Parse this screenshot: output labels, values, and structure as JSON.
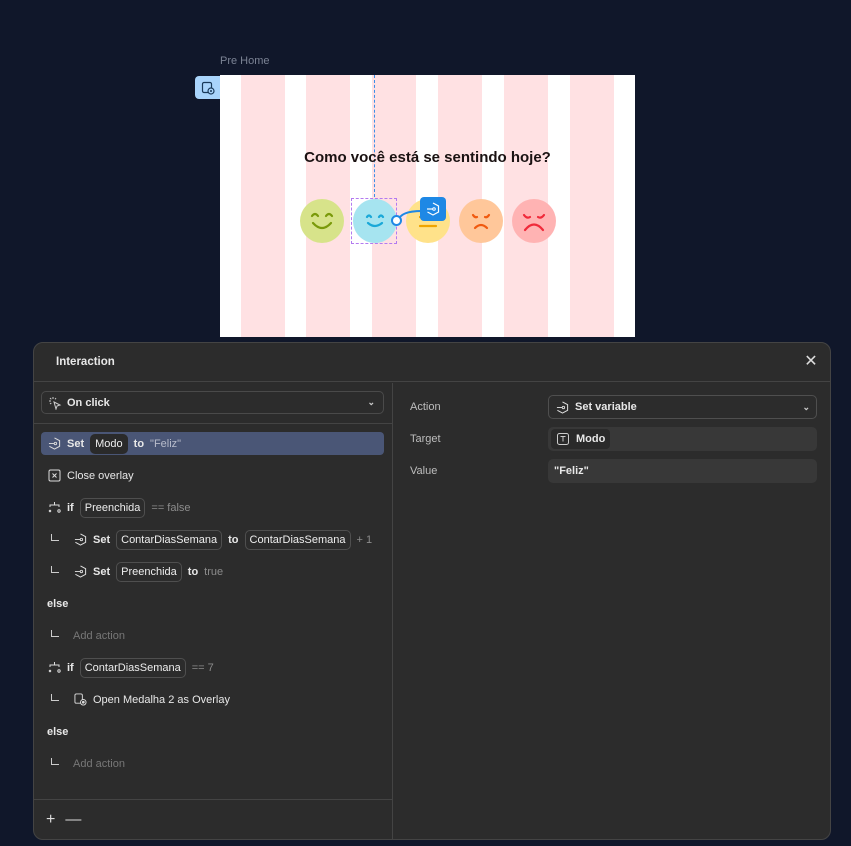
{
  "frame": {
    "label": "Pre Home",
    "question": "Como você está se sentindo hoje?"
  },
  "emojis": [
    {
      "name": "very-happy",
      "color": "#d7e38a",
      "stroke": "#7a9a0a"
    },
    {
      "name": "happy",
      "color": "#a6e4f0",
      "stroke": "#1aa8d8"
    },
    {
      "name": "neutral",
      "color": "#ffe28a",
      "stroke": "#f0a500"
    },
    {
      "name": "sad",
      "color": "#ffc79a",
      "stroke": "#f05a10"
    },
    {
      "name": "very-sad",
      "color": "#ffb3b3",
      "stroke": "#f02a3a"
    }
  ],
  "panel": {
    "title": "Interaction",
    "trigger": "On click",
    "rows": {
      "r1": {
        "set": "Set",
        "var": "Modo",
        "to": "to",
        "value": "\"Feliz\""
      },
      "r2": {
        "label": "Close overlay"
      },
      "r3": {
        "if": "if",
        "var": "Preenchida",
        "cond": "== false"
      },
      "r4": {
        "set": "Set",
        "var": "ContarDiasSemana",
        "to": "to",
        "var2": "ContarDiasSemana",
        "op": "+ 1"
      },
      "r5": {
        "set": "Set",
        "var": "Preenchida",
        "to": "to",
        "value": "true"
      },
      "r6": {
        "label": "else"
      },
      "r7": {
        "label": "Add action"
      },
      "r8": {
        "if": "if",
        "var": "ContarDiasSemana",
        "cond": "== 7"
      },
      "r9": {
        "label": "Open Medalha 2 as Overlay"
      },
      "r10": {
        "label": "else"
      },
      "r11": {
        "label": "Add action"
      }
    },
    "footer": {
      "add": "+",
      "remove": "—"
    },
    "details": {
      "action_label": "Action",
      "action_value": "Set variable",
      "target_label": "Target",
      "target_value": "Modo",
      "value_label": "Value",
      "value_value": "\"Feliz\""
    }
  }
}
